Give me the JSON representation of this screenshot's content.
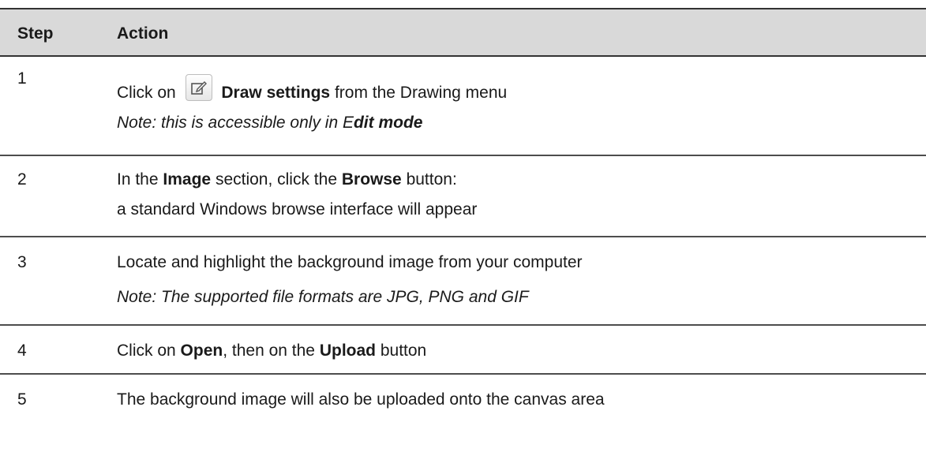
{
  "header": {
    "step": "Step",
    "action": "Action"
  },
  "rows": [
    {
      "step": "1",
      "pre": "Click on",
      "bold": "Draw settings",
      "post": "from the Drawing menu",
      "note_pre": "Note: this is accessible only in E",
      "note_bold": "dit mode",
      "icon": "edit-icon"
    },
    {
      "step": "2",
      "l1_a": "In the",
      "l1_b": "Image",
      "l1_c": "section, click the",
      "l1_d": "Browse",
      "l1_e": "button:",
      "l2": "a standard Windows browse interface will appear"
    },
    {
      "step": "3",
      "l1": "Locate and highlight the background image from your computer",
      "note": "Note: The supported file formats are JPG, PNG and GIF"
    },
    {
      "step": "4",
      "a": "Click on",
      "b": "Open",
      "c": ", then on the",
      "d": "Upload",
      "e": "button"
    },
    {
      "step": "5",
      "l1": "The background image will also be uploaded onto the canvas area"
    }
  ]
}
